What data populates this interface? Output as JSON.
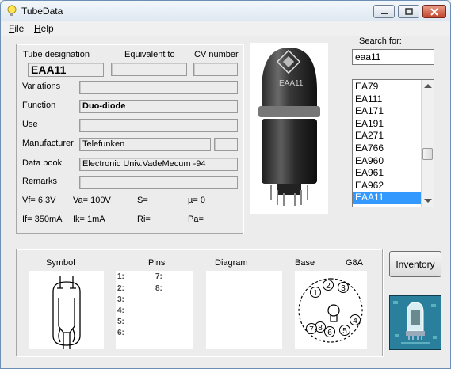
{
  "window": {
    "title": "TubeData"
  },
  "menu": {
    "file": "File",
    "help": "Help"
  },
  "details": {
    "tube_designation_label": "Tube designation",
    "tube_designation": "EAA11",
    "equivalent_label": "Equivalent to",
    "equivalent": "",
    "cv_label": "CV number",
    "cv": "",
    "variations_label": "Variations",
    "variations": "",
    "function_label": "Function",
    "function": "Duo-diode",
    "use_label": "Use",
    "use": "",
    "manufacturer_label": "Manufacturer",
    "manufacturer": "Telefunken",
    "manufacturer_extra": "",
    "databook_label": "Data book",
    "databook": "Electronic Univ.VadeMecum -94",
    "remarks_label": "Remarks",
    "remarks": ""
  },
  "params": {
    "vf": "Vf= 6,3V",
    "va": "Va= 100V",
    "s": "S=",
    "mu": "µ=   0",
    "if": "If= 350mA",
    "ik": "Ik=  1mA",
    "ri": "Ri=",
    "pa": "Pa="
  },
  "search": {
    "label": "Search for:",
    "value": "eaa11",
    "results": [
      "EA79",
      "EA111",
      "EA171",
      "EA191",
      "EA271",
      "EA766",
      "EA960",
      "EA961",
      "EA962",
      "EAA11"
    ],
    "selected": "EAA11"
  },
  "bottom": {
    "symbol_label": "Symbol",
    "pins_label": "Pins",
    "diagram_label": "Diagram",
    "base_label": "Base",
    "base_type": "G8A",
    "pins_left": [
      "1:",
      "2:",
      "3:",
      "4:",
      "5:",
      "6:"
    ],
    "pins_right": [
      "7:",
      "8:"
    ],
    "base_pin_numbers": [
      "1",
      "2",
      "3",
      "4",
      "5",
      "6",
      "7",
      "8"
    ]
  },
  "photo": {
    "tube_marking": "EAA11"
  },
  "inventory_button": "Inventory",
  "colors": {
    "selection": "#3399ff",
    "titlebar": "#dfe8f2",
    "close": "#c4452b"
  }
}
